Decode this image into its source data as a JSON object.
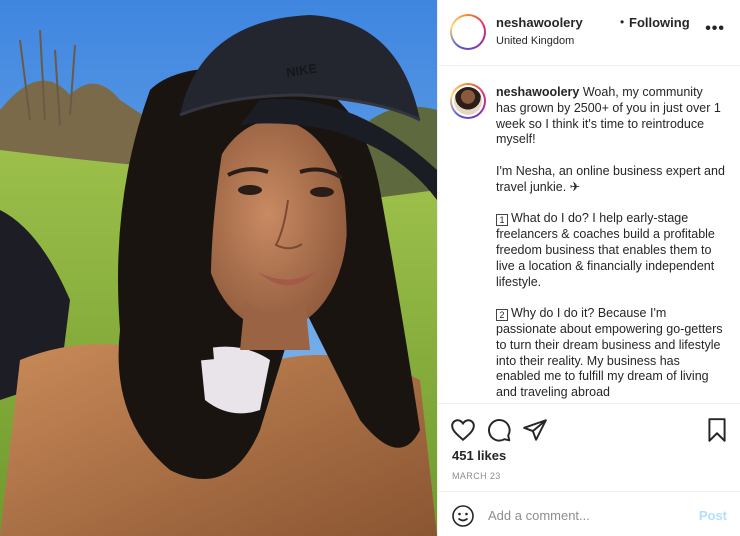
{
  "header": {
    "username": "neshawoolery",
    "separator": "•",
    "follow_status": "Following",
    "location": "United Kingdom",
    "more_label": "•••"
  },
  "caption": {
    "username": "neshawoolery",
    "para1": "Woah, my community has grown by 2500+ of you in just over 1 week so I think it's time to reintroduce myself!",
    "para2": "I'm Nesha, an online business expert and travel junkie. ✈",
    "num1": "1",
    "para3": "What do I do? I help early-stage freelancers & coaches build a profitable freedom business that enables them to live a location & financially independent lifestyle.",
    "num2": "2",
    "para4": "Why do I do it? Because I'm passionate about empowering go-getters to turn their dream business and lifestyle into their reality. My business has enabled me to fulfill my dream of living and traveling abroad"
  },
  "actions": {
    "icons": [
      "heart-icon",
      "comment-icon",
      "share-icon",
      "bookmark-icon"
    ]
  },
  "likes": "451 likes",
  "date": "MARCH 23",
  "comment": {
    "placeholder": "Add a comment...",
    "post_label": "Post",
    "icon": "emoji-icon"
  },
  "colors": {
    "text": "#262626",
    "muted": "#8e8e8e",
    "post_disabled": "#b2dffc",
    "divider": "#efefef"
  }
}
